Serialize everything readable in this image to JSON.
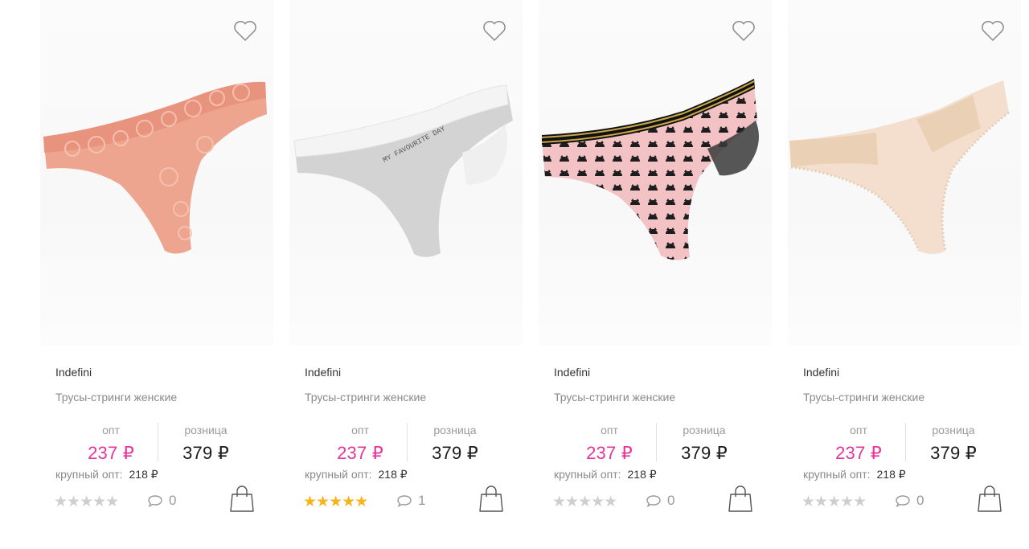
{
  "products": [
    {
      "brand": "Indefini",
      "title": "Трусы-стринги женские",
      "opt_label": "опт",
      "opt_price": "237 ₽",
      "retail_label": "розница",
      "retail_price": "379 ₽",
      "bulk_label": "крупный опт:",
      "bulk_price": "218 ₽",
      "rating": "★★★★★",
      "rating_value": 0,
      "reviews": "0",
      "color": "#eda58f",
      "accent": "#e08a76"
    },
    {
      "brand": "Indefini",
      "title": "Трусы-стринги женские",
      "opt_label": "опт",
      "opt_price": "237 ₽",
      "retail_label": "розница",
      "retail_price": "379 ₽",
      "bulk_label": "крупный опт:",
      "bulk_price": "218 ₽",
      "rating": "★★★★★",
      "rating_value": 5,
      "reviews": "1",
      "print_text": "MY FAVOURITE DAY",
      "color": "#d0d0d0",
      "accent": "#f2f2f2"
    },
    {
      "brand": "Indefini",
      "title": "Трусы-стринги женские",
      "opt_label": "опт",
      "opt_price": "237 ₽",
      "retail_label": "розница",
      "retail_price": "379 ₽",
      "bulk_label": "крупный опт:",
      "bulk_price": "218 ₽",
      "rating": "★★★★★",
      "rating_value": 0,
      "reviews": "0",
      "color": "#f2c2c4",
      "accent": "#1d1d1d"
    },
    {
      "brand": "Indefini",
      "title": "Трусы-стринги женские",
      "opt_label": "опт",
      "opt_price": "237 ₽",
      "retail_label": "розница",
      "retail_price": "379 ₽",
      "bulk_label": "крупный опт:",
      "bulk_price": "218 ₽",
      "rating": "★★★★★",
      "rating_value": 0,
      "reviews": "0",
      "color": "#f3dcca",
      "accent": "#ead0b4"
    }
  ],
  "colors": {
    "opt_price": "#e5369a",
    "star_filled": "#f6b51e",
    "star_empty": "#cfcfcf"
  },
  "icons": {
    "favorite": "heart-outline-icon",
    "reviews": "speech-bubble-icon",
    "cart": "shopping-bag-icon"
  }
}
